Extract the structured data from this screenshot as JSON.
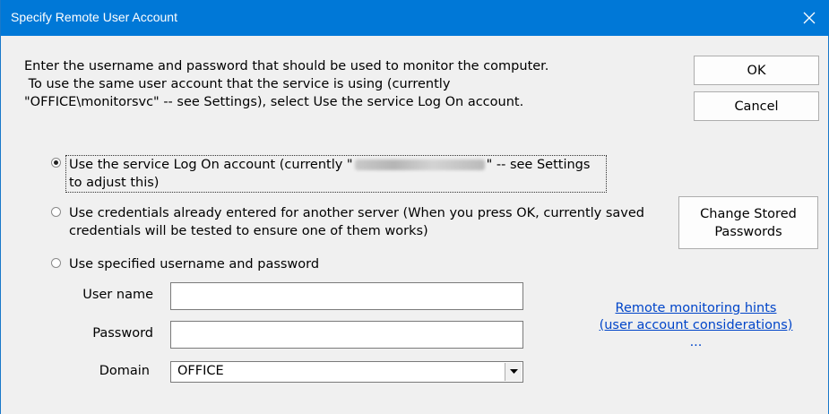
{
  "window": {
    "title": "Specify Remote User Account",
    "close_icon": "close-icon",
    "colors": {
      "titlebar": "#0078d7",
      "link": "#0045c9",
      "background": "#f0f0f0"
    }
  },
  "intro": {
    "text": "Enter the username and password that should be used to monitor the computer.\n To use the same user account that the service is using (currently\n\"OFFICE\\monitorsvc\" -- see Settings), select Use the service Log On account."
  },
  "buttons": {
    "ok": "OK",
    "cancel": "Cancel",
    "change_stored": "Change Stored Passwords"
  },
  "options": {
    "selected": "service_logon",
    "service_logon": {
      "label_before": "Use the service Log On account (currently \"",
      "label_after": "\" -- see Settings to adjust this)"
    },
    "other_server": {
      "label": "Use credentials already entered for another server (When you press OK, currently saved credentials will be tested to ensure one of them works)"
    },
    "specified": {
      "label": "Use specified username and password"
    }
  },
  "fields": {
    "username_label": "User name",
    "username_value": "",
    "password_label": "Password",
    "password_value": "",
    "domain_label": "Domain",
    "domain_value": "OFFICE"
  },
  "hints": {
    "link_line1": "Remote monitoring hints",
    "link_line2": "(user account considerations)",
    "ellipsis": "..."
  }
}
